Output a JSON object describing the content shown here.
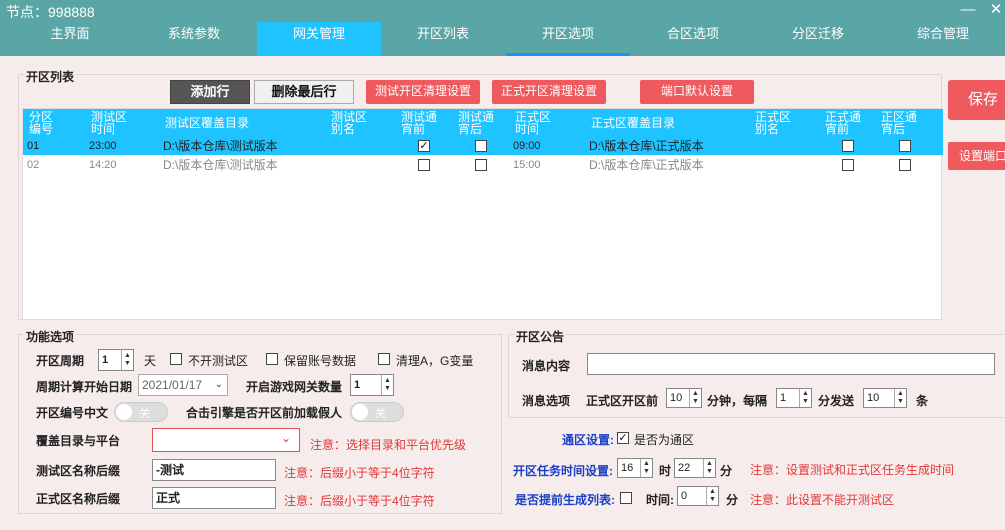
{
  "window": {
    "title": "节点：998888",
    "minimize": "—",
    "close": "✕"
  },
  "nav": [
    "主界面",
    "系统参数",
    "网关管理",
    "开区列表",
    "开区选项",
    "合区选项",
    "分区迁移",
    "综合管理"
  ],
  "list_section": {
    "title": "开区列表",
    "add_row": "添加行",
    "delete_last": "删除最后行",
    "test_clean": "测试开区清理设置",
    "formal_clean": "正式开区清理设置",
    "port_default": "端口默认设置",
    "save": "保存",
    "set_port": "设置端口",
    "headers": {
      "zone_no_1": "分区",
      "zone_no_2": "编号",
      "test_time_1": "测试区",
      "test_time_2": "时间",
      "test_dir": "测试区覆盖目录",
      "test_alias_1": "测试区",
      "test_alias_2": "别名",
      "test_before_1": "测试通",
      "test_before_2": "宵前",
      "test_after_1": "测试通",
      "test_after_2": "宵后",
      "formal_time_1": "正式区",
      "formal_time_2": "时间",
      "formal_dir": "正式区覆盖目录",
      "formal_alias_1": "正式区",
      "formal_alias_2": "别名",
      "formal_before_1": "正式通",
      "formal_before_2": "宵前",
      "formal_after_1": "正区通",
      "formal_after_2": "宵后"
    },
    "rows": [
      {
        "no": "01",
        "test_time": "23:00",
        "test_dir": "D:\\版本仓库\\测试版本",
        "test_before": "✓",
        "test_after": "",
        "formal_time": "09:00",
        "formal_dir": "D:\\版本仓库\\正式版本",
        "formal_before": "",
        "formal_after": ""
      },
      {
        "no": "02",
        "test_time": "14:20",
        "test_dir": "D:\\版本仓库\\测试版本",
        "test_before": "",
        "test_after": "",
        "formal_time": "15:00",
        "formal_dir": "D:\\版本仓库\\正式版本",
        "formal_before": "",
        "formal_after": ""
      }
    ]
  },
  "func_section": {
    "title": "功能选项",
    "cycle_label": "开区周期",
    "cycle_value": "1",
    "cycle_unit": "天",
    "no_test": "不开测试区",
    "keep_account": "保留账号数据",
    "clear_ag": "清理A，G变量",
    "start_date_label": "周期计算开始日期",
    "start_date": "2021/01/17",
    "gateway_count_label": "开启游戏网关数量",
    "gateway_count": "1",
    "zone_cn_label": "开区编号中文",
    "zone_cn_state": "关",
    "fake_label": "合击引擎是否开区前加载假人",
    "fake_state": "关",
    "cover_label": "覆盖目录与平台",
    "cover_warn": "注意：选择目录和平台优先级",
    "test_suffix_label": "测试区名称后缀",
    "test_suffix": "-测试",
    "test_suffix_warn": "注意：后缀小于等于4位字符",
    "formal_suffix_label": "正式区名称后缀",
    "formal_suffix": "正式",
    "formal_suffix_warn": "注意：后缀小于等于4位字符"
  },
  "notice_section": {
    "title": "开区公告",
    "content_label": "消息内容",
    "content_value": "",
    "options_label": "消息选项",
    "before_label": "正式区开区前",
    "before_value": "10",
    "minute_every": "分钟，每隔",
    "every_value": "1",
    "minute_send": "分发送",
    "send_value": "10",
    "unit_tiao": "条"
  },
  "bottom": {
    "tongqu_label": "通区设置:",
    "tongqu_check": "✓",
    "tongqu_text": "是否为通区",
    "task_label": "开区任务时间设置:",
    "task_hour": "16",
    "hour_unit": "时",
    "task_min": "22",
    "min_unit": "分",
    "task_warn": "注意：设置测试和正式区任务生成时间",
    "pregen_label": "是否提前生成列表:",
    "time_label": "时间:",
    "pregen_min": "0",
    "pregen_unit": "分",
    "pregen_warn": "注意：此设置不能开测试区"
  }
}
